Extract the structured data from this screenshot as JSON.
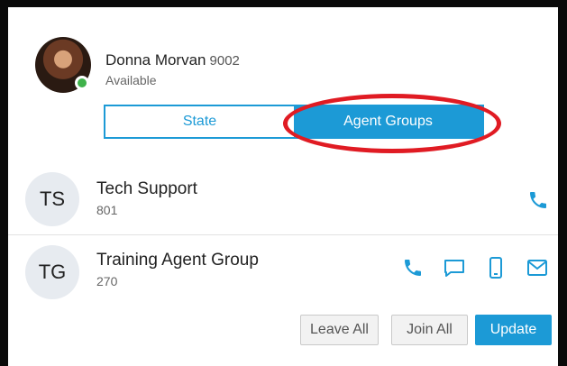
{
  "user": {
    "name": "Donna Morvan",
    "extension": "9002",
    "status": "Available",
    "status_color": "#3fb24b"
  },
  "tabs": [
    {
      "label": "State",
      "selected": false
    },
    {
      "label": "Agent Groups",
      "selected": true
    }
  ],
  "groups": [
    {
      "initials": "TS",
      "name": "Tech Support",
      "number": "801",
      "icons": [
        "phone-icon"
      ]
    },
    {
      "initials": "TG",
      "name": "Training Agent Group",
      "number": "270",
      "icons": [
        "phone-icon",
        "chat-icon",
        "mobile-icon",
        "mail-icon"
      ]
    }
  ],
  "actions": {
    "leave_all": "Leave All",
    "join_all": "Join All",
    "update": "Update"
  },
  "colors": {
    "accent": "#1c9ad6",
    "highlight_ellipse": "#e01b23"
  }
}
